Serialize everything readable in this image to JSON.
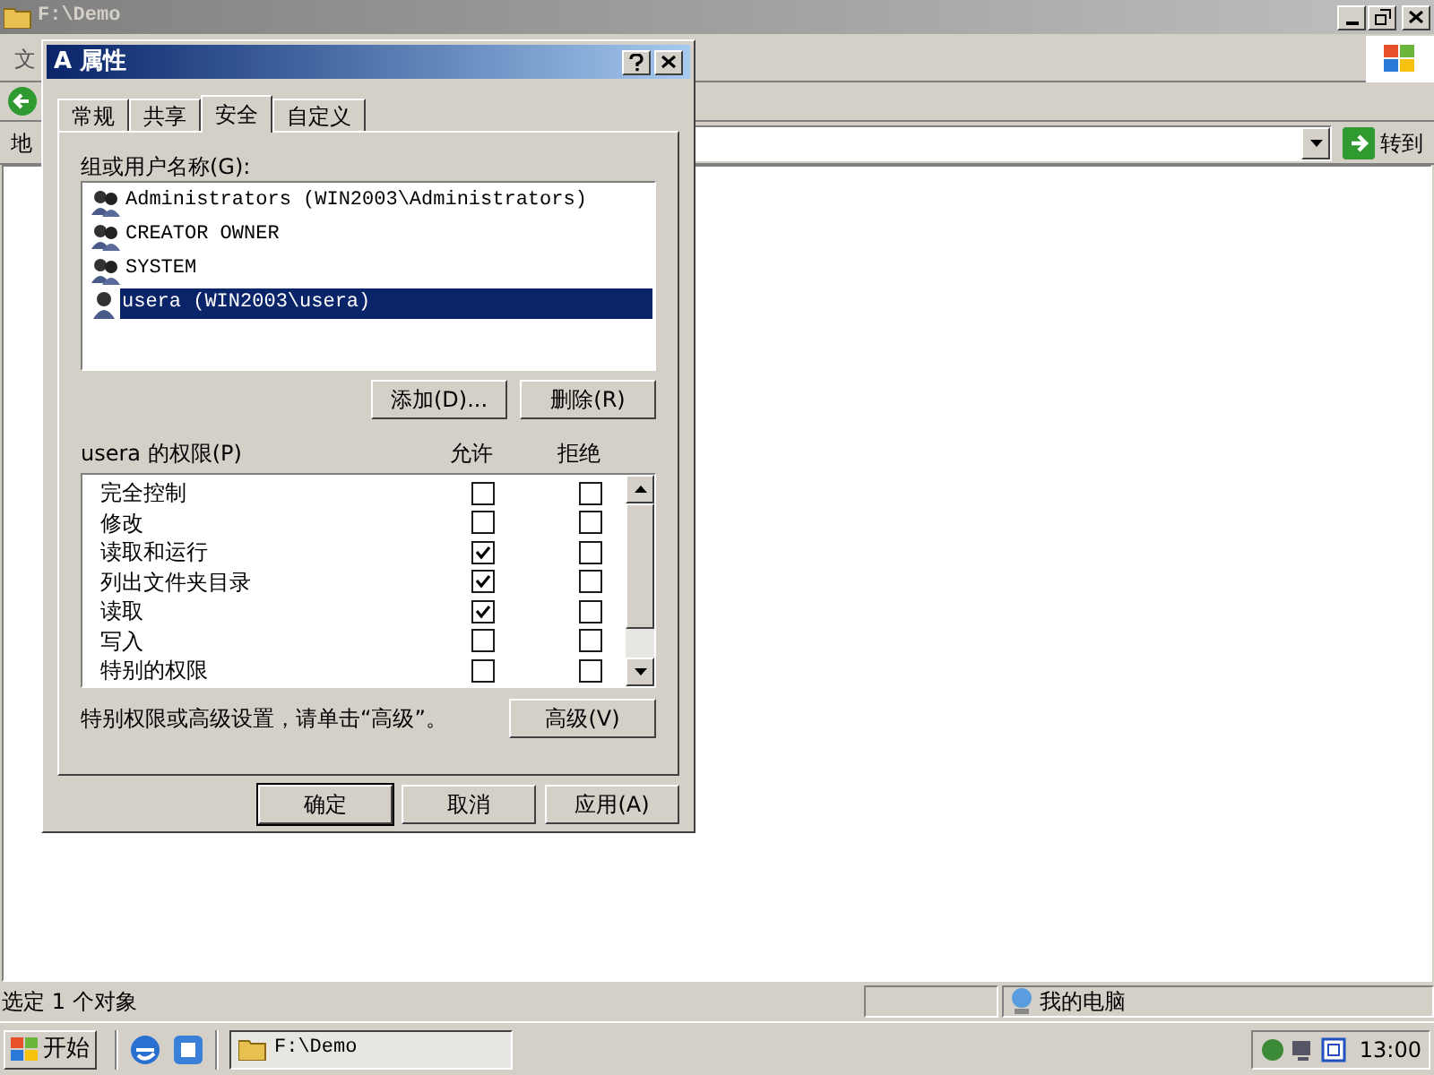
{
  "explorer": {
    "title": "F:\\Demo",
    "menu": [
      "文"
    ],
    "address": {
      "label": "地",
      "go": "转到"
    },
    "status_bar": {
      "text": "选定 1 个对象",
      "location": "我的电脑"
    }
  },
  "dialog": {
    "title": "A 属性",
    "tabs": [
      {
        "label": "常规",
        "selected": false
      },
      {
        "label": "共享",
        "selected": false
      },
      {
        "label": "安全",
        "selected": true
      },
      {
        "label": "自定义",
        "selected": false
      }
    ],
    "groups_label": "组或用户名称(G):",
    "principals": [
      {
        "name": "Administrators (WIN2003\\Administrators)",
        "kind": "group",
        "selected": false
      },
      {
        "name": "CREATOR OWNER",
        "kind": "group",
        "selected": false
      },
      {
        "name": "SYSTEM",
        "kind": "group",
        "selected": false
      },
      {
        "name": "usera (WIN2003\\usera)",
        "kind": "user",
        "selected": true
      }
    ],
    "principal_buttons": [
      "添加(D)...",
      "删除(R)"
    ],
    "permissions_label": "usera 的权限(P)",
    "allow_label": "允许",
    "deny_label": "拒绝",
    "permissions": [
      {
        "name": "完全控制",
        "allow": false,
        "deny": false
      },
      {
        "name": "修改",
        "allow": false,
        "deny": false
      },
      {
        "name": "读取和运行",
        "allow": true,
        "deny": false
      },
      {
        "name": "列出文件夹目录",
        "allow": true,
        "deny": false
      },
      {
        "name": "读取",
        "allow": true,
        "deny": false
      },
      {
        "name": "写入",
        "allow": false,
        "deny": false
      },
      {
        "name": "特别的权限",
        "allow": false,
        "deny": false
      }
    ],
    "advanced_note": "特别权限或高级设置，请单击“高级”。",
    "advanced_button": "高级(V)",
    "footer_buttons": [
      {
        "label": "确定",
        "default": true
      },
      {
        "label": "取消",
        "default": false
      },
      {
        "label": "应用(A)",
        "default": false
      }
    ]
  },
  "taskbar": {
    "start": "开始",
    "task": "F:\\Demo",
    "clock": "13:00"
  }
}
